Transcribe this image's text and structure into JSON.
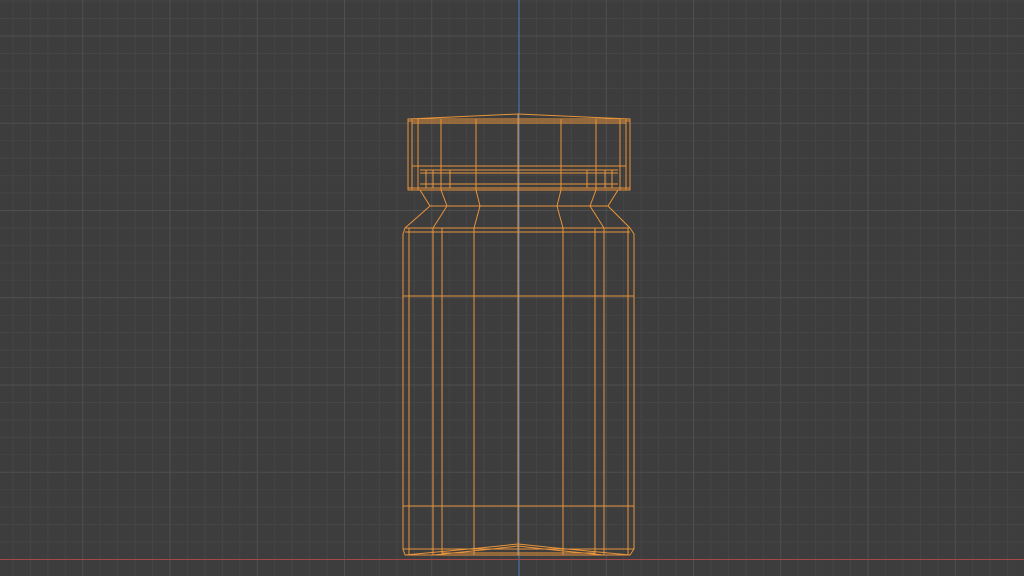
{
  "viewport": {
    "view": "front-orthographic",
    "shading": "wireframe",
    "object": {
      "name": "jar",
      "parts": [
        "cap",
        "neck",
        "body",
        "base"
      ],
      "selected": true
    },
    "grid": {
      "visible": true,
      "subdivisions_per_major": 5
    },
    "axes": {
      "vertical_axis_visible": true,
      "horizontal_axis_visible": true
    },
    "colors": {
      "background": "#3d3d3d",
      "grid_minor": "#454545",
      "grid_major": "#4f4f4f",
      "axis_vertical": "#4a7db8",
      "axis_horizontal": "#a8474a",
      "wireframe_selected": "#e8943a"
    }
  }
}
